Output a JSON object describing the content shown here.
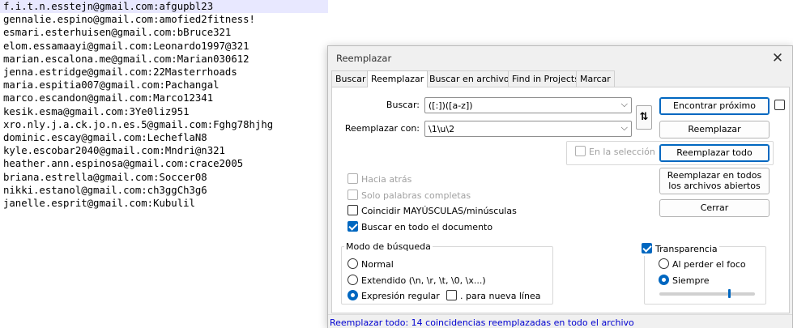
{
  "editor": {
    "lines": [
      "f.i.t.n.esstejn@gmail.com:afgupbl23",
      "gennalie.espino@gmail.com:amofied2fitness!",
      "esmari.esterhuisen@gmail.com:bBruce321",
      "elom.essamaayi@gmail.com:Leonardo1997@321",
      "marian.escalona.me@gmail.com:Marian030612",
      "jenna.estridge@gmail.com:22Masterrhoads",
      "maria.espitia007@gmail.com:Pachangal",
      "marco.escandon@gmail.com:Marco12341",
      "kesik.esma@gmail.com:3Ye0liz951",
      "xro.nly.j.a.ck.jo.n.es.5@gmail.com:Fghg78hjhg",
      "dominic.escay@gmail.com:LecheflaN8",
      "kyle.escobar2040@gmail.com:Mndri@n321",
      "heather.ann.espinosa@gmail.com:crace2005",
      "briana.estrella@gmail.com:Soccer08",
      "nikki.estanol@gmail.com:ch3ggCh3g6",
      "janelle.esprit@gmail.com:Kubulil"
    ]
  },
  "dialog": {
    "title": "Reemplazar",
    "close_glyph": "✕",
    "tabs": [
      "Buscar",
      "Reemplazar",
      "Buscar en archivos",
      "Find in Projects",
      "Marcar"
    ],
    "active_tab": "Reemplazar",
    "find_label": "Buscar:",
    "find_value": "([:])([a-z])",
    "replace_label": "Reemplazar con:",
    "replace_value": "\\1\\u\\2",
    "swap_glyph": "⇅",
    "chevron": "⌵",
    "in_selection": "En la selección",
    "buttons": {
      "find_next": "Encontrar próximo",
      "replace": "Reemplazar",
      "replace_all": "Reemplazar todo",
      "replace_all_open": "Reemplazar en todos los archivos abiertos",
      "close": "Cerrar"
    },
    "options": {
      "backward": "Hacia atrás",
      "whole_word": "Solo palabras completas",
      "match_case": "Coincidir MAYÚSCULAS/minúsculas",
      "wrap_around": "Buscar en todo el documento"
    },
    "search_mode": {
      "title": "Modo de búsqueda",
      "normal": "Normal",
      "extended": "Extendido (\\n, \\r, \\t, \\0, \\x...)",
      "regex": "Expresión regular",
      "dot_newline": ". para nueva línea",
      "selected": "regex"
    },
    "transparency": {
      "title": "Transparencia",
      "checked": true,
      "on_lose_focus": "Al perder el foco",
      "always": "Siempre",
      "selected": "always",
      "level": 0.72
    },
    "status": "Reemplazar todo: 14 coincidencias reemplazadas en todo el archivo",
    "colors": {
      "accent": "#0067c0",
      "status_text": "#0000d0"
    }
  }
}
